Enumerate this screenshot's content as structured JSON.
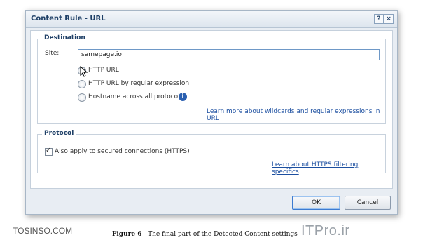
{
  "dialog": {
    "title": "Content Rule - URL",
    "help_label": "?",
    "close_label": "×"
  },
  "destination": {
    "legend": "Destination",
    "site_label": "Site:",
    "site_value": "samepage.io",
    "options": [
      {
        "label": "HTTP URL",
        "selected": true
      },
      {
        "label": "HTTP URL by regular expression",
        "selected": false
      },
      {
        "label": "Hostname across all protocols",
        "selected": false
      }
    ],
    "info_icon": "info-icon",
    "learn_link": "Learn more about wildcards and regular expressions in URL"
  },
  "protocol": {
    "legend": "Protocol",
    "checkbox_label": "Also apply to secured connections (HTTPS)",
    "checkbox_checked": true,
    "learn_link": "Learn about HTTPS filtering specifics"
  },
  "buttons": {
    "ok": "OK",
    "cancel": "Cancel"
  },
  "watermark": {
    "left": "TOSINSO.COM",
    "right": "ITPro.ir"
  },
  "caption": {
    "figure": "Figure 6",
    "text": "The final part of the Detected Content settings"
  },
  "colors": {
    "accent": "#1e3f66",
    "link": "#1c4fa0",
    "dialog_bg": "#e8edf3"
  }
}
